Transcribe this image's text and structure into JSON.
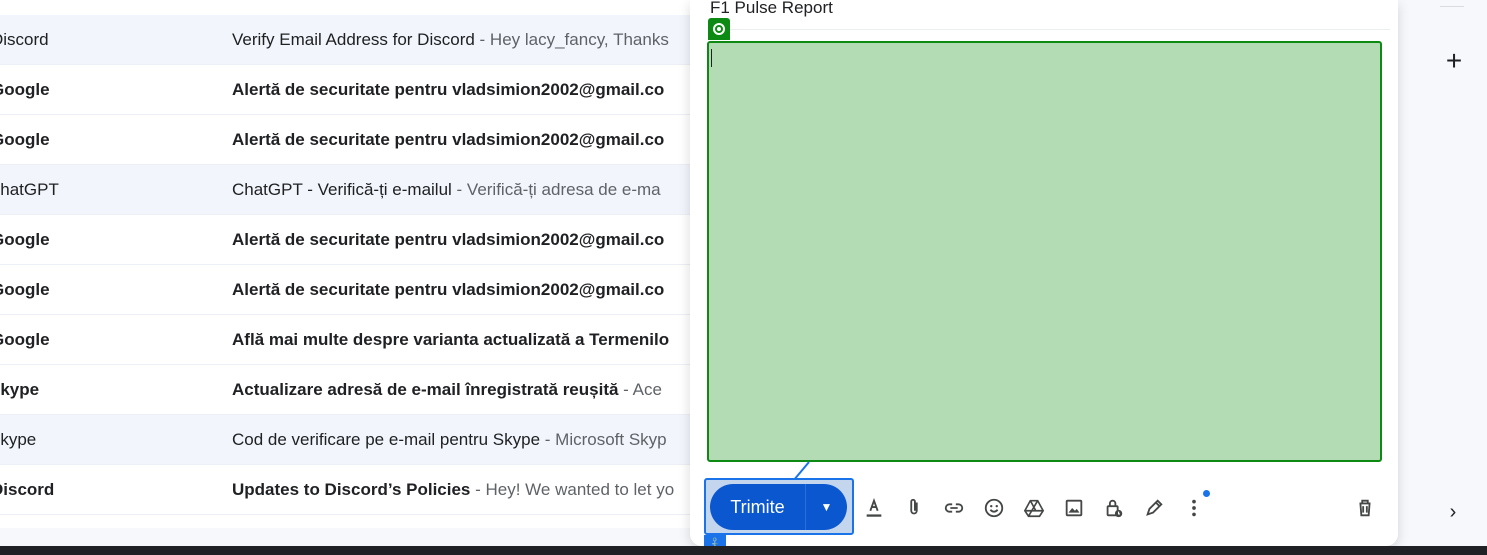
{
  "mail_list": [
    {
      "sender": "Discord",
      "subject": "Verify Email Address for Discord",
      "snippet": " - Hey lacy_fancy, Thanks",
      "unread": false
    },
    {
      "sender": "Google",
      "subject": "Alertă de securitate pentru vladsimion2002@gmail.co",
      "snippet": "",
      "unread": true
    },
    {
      "sender": "Google",
      "subject": "Alertă de securitate pentru vladsimion2002@gmail.co",
      "snippet": "",
      "unread": true
    },
    {
      "sender": "ChatGPT",
      "subject": "ChatGPT - Verifică-ți e-mailul",
      "snippet": " - Verifică-ți adresa de e-ma",
      "unread": false
    },
    {
      "sender": "Google",
      "subject": "Alertă de securitate pentru vladsimion2002@gmail.co",
      "snippet": "",
      "unread": true
    },
    {
      "sender": "Google",
      "subject": "Alertă de securitate pentru vladsimion2002@gmail.co",
      "snippet": "",
      "unread": true
    },
    {
      "sender": "Google",
      "subject": "Află mai multe despre varianta actualizată a Termenilo",
      "snippet": "",
      "unread": true
    },
    {
      "sender": "Skype",
      "subject": "Actualizare adresă de e-mail înregistrată reușită",
      "snippet": " - Ace",
      "unread": true
    },
    {
      "sender": "Skype",
      "subject": "Cod de verificare pe e-mail pentru Skype",
      "snippet": " - Microsoft Skyp",
      "unread": false
    },
    {
      "sender": "Discord",
      "subject": "Updates to Discord’s Policies",
      "snippet": " - Hey! We wanted to let yo",
      "unread": true
    }
  ],
  "compose": {
    "subject": "F1 Pulse Report",
    "body": "",
    "send_label": "Trimite",
    "body_color": "#b3dcb4",
    "highlight_color": "#0d8a14",
    "accent": "#1a73e8"
  },
  "toolbar_icons": [
    "text-format-icon",
    "attach-icon",
    "link-icon",
    "emoji-icon",
    "drive-icon",
    "image-icon",
    "confidential-lock-icon",
    "signature-pen-icon",
    "more-options-icon",
    "delete-icon"
  ],
  "side_rail": {
    "add_label": "+",
    "expand_label": "›"
  }
}
